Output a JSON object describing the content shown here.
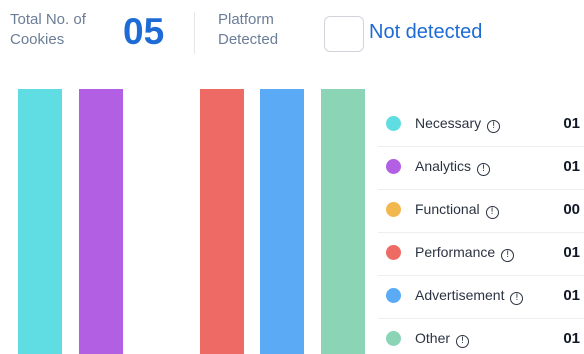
{
  "summary": {
    "total_label": "Total No. of Cookies",
    "total_value": "05",
    "platform_label": "Platform Detected",
    "platform_value": "Not detected"
  },
  "chart_data": {
    "type": "bar",
    "categories": [
      "Necessary",
      "Analytics",
      "Functional",
      "Performance",
      "Advertisement",
      "Other"
    ],
    "values": [
      1,
      1,
      0,
      1,
      1,
      1
    ],
    "colors": [
      "#5fdde3",
      "#b35fe3",
      "#f2b84f",
      "#ee6a64",
      "#5aaaf5",
      "#8cd4b6"
    ]
  },
  "legend": [
    {
      "label": "Necessary",
      "count": "01",
      "color": "#5fdde3",
      "icon": "info-icon"
    },
    {
      "label": "Analytics",
      "count": "01",
      "color": "#b35fe3",
      "icon": "info-icon"
    },
    {
      "label": "Functional",
      "count": "00",
      "color": "#f2b84f",
      "icon": "info-icon"
    },
    {
      "label": "Performance",
      "count": "01",
      "color": "#ee6a64",
      "icon": "info-icon"
    },
    {
      "label": "Advertisement",
      "count": "01",
      "color": "#5aaaf5",
      "icon": "info-icon"
    },
    {
      "label": "Other",
      "count": "01",
      "color": "#8cd4b6",
      "icon": "info-icon"
    }
  ],
  "colors": {
    "accent": "#1d6bd6",
    "muted_text": "#6b7d97"
  }
}
